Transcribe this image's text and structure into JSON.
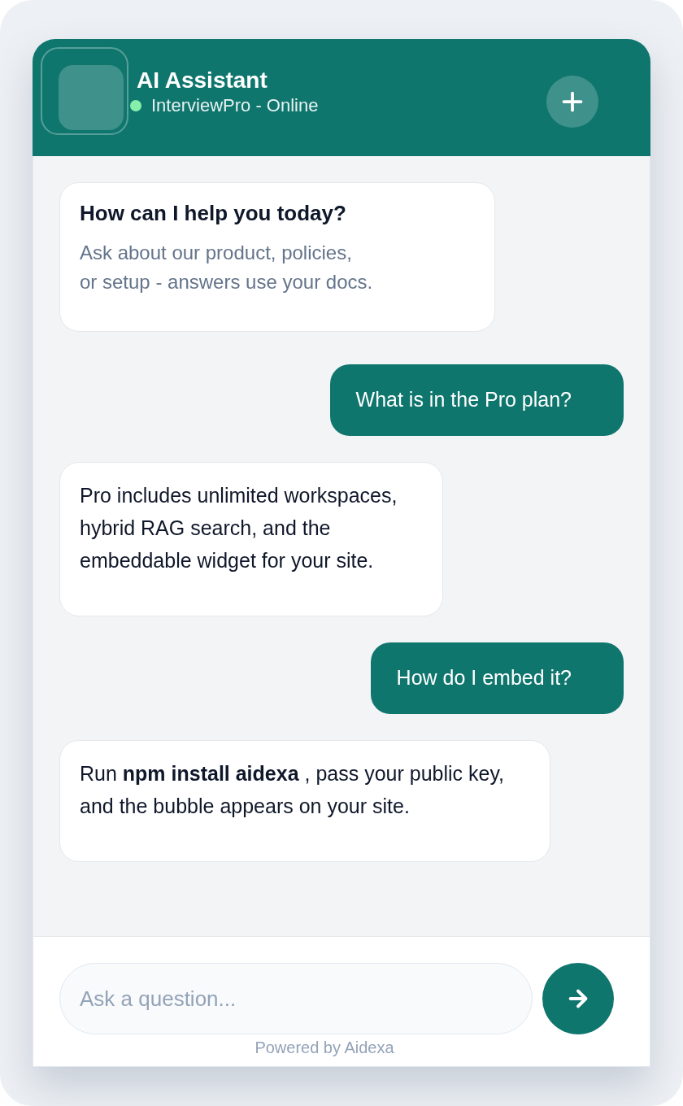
{
  "header": {
    "title": "AI Assistant",
    "subtitle": "InterviewPro - Online",
    "online": true
  },
  "messages": [
    {
      "kind": "welcome",
      "title": "How can I help you today?",
      "text": "Ask about our product, policies,\nor setup - answers use your docs."
    },
    {
      "kind": "user",
      "text": "What is in the Pro plan?"
    },
    {
      "kind": "assistant",
      "text": "Pro includes unlimited workspaces,\nhybrid RAG search, and the\nembeddable widget for your site."
    },
    {
      "kind": "user",
      "text": "How do I embed it?"
    },
    {
      "kind": "assistant",
      "text": "Run **npm install aidexa** , pass your public key,\nand the bubble appears on your site."
    }
  ],
  "composer": {
    "placeholder": "Ask a question..."
  },
  "footer": "Powered by Aidexa"
}
